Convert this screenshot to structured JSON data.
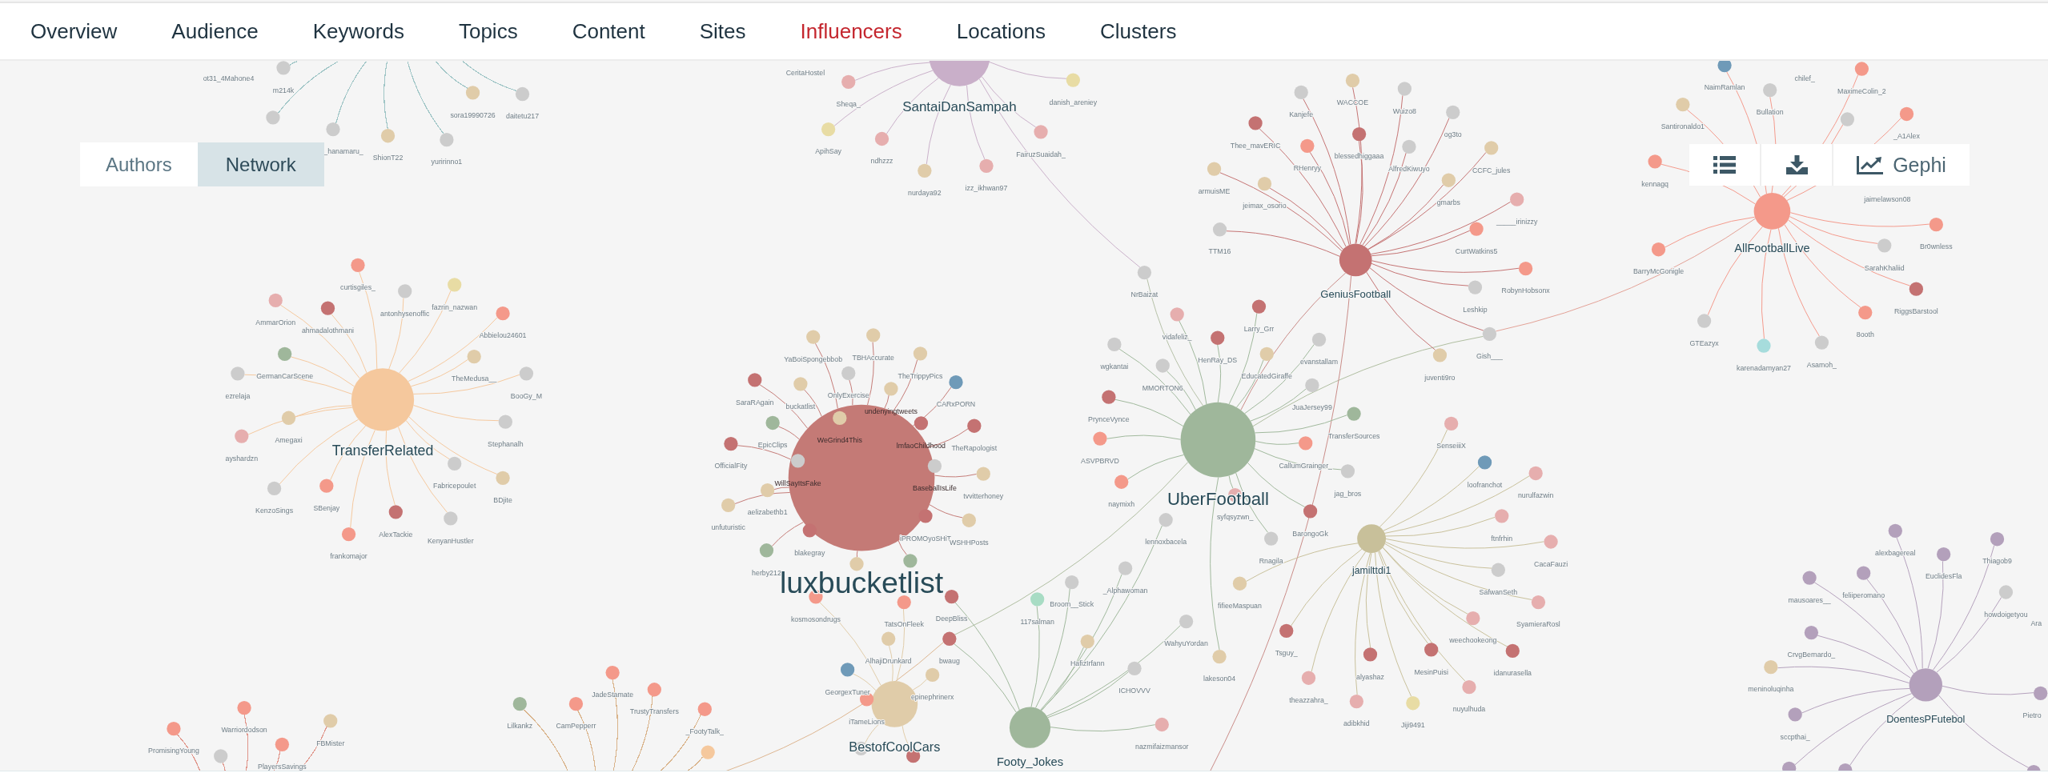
{
  "tabs": [
    {
      "label": "Overview",
      "selected": false
    },
    {
      "label": "Audience",
      "selected": false
    },
    {
      "label": "Keywords",
      "selected": false
    },
    {
      "label": "Topics",
      "selected": false
    },
    {
      "label": "Content",
      "selected": false
    },
    {
      "label": "Sites",
      "selected": false
    },
    {
      "label": "Influencers",
      "selected": true
    },
    {
      "label": "Locations",
      "selected": false
    },
    {
      "label": "Clusters",
      "selected": false
    }
  ],
  "view_toggle": [
    {
      "label": "Authors",
      "selected": false
    },
    {
      "label": "Network",
      "selected": true
    }
  ],
  "toolbar": [
    {
      "kind": "list"
    },
    {
      "kind": "download"
    },
    {
      "kind": "chart",
      "label": "Gephi"
    }
  ],
  "network": {
    "clusters": [
      {
        "color": "#9fc5c6",
        "leaves": [
          {
            "label": "ot31_4Mahone4"
          },
          {
            "label": "m214k",
            "color": "#cccccc"
          },
          {
            "label": "sora19990726",
            "color": "#e0cca9"
          },
          {
            "label": "daitetu217",
            "color": "#cccccc"
          },
          {
            "color": "#cccccc"
          },
          {
            "label": "_hanamaru_",
            "color": "#cccccc"
          },
          {
            "label": "ShionT22",
            "color": "#e0cca9"
          },
          {
            "label": "yuririnno1",
            "color": "#cccccc"
          }
        ]
      },
      {
        "color": "#c9afc9",
        "hub": {
          "label": "SantaiDanSampah"
        },
        "leaves": [
          {
            "label": "CeritaHostel"
          },
          {
            "label": "Sheqa_",
            "color": "#e6aeae"
          },
          {
            "label": "danish_areniey",
            "color": "#e8dca4"
          },
          {
            "label": "ApihSay",
            "color": "#e8dca4"
          },
          {
            "label": "ndhzzz",
            "color": "#e6aeae"
          },
          {
            "label": "FairuzSuaidah_",
            "color": "#e6aeae"
          },
          {
            "label": "nurdaya92",
            "color": "#e0cca9"
          },
          {
            "label": "izz_ikhwan97",
            "color": "#e6aeae"
          },
          {
            "label": "NrBaizat",
            "color": "#cccccc"
          }
        ]
      },
      {
        "color": "#c47272",
        "hub": {
          "label": "GeniusFootball"
        },
        "leaves": [
          {
            "label": "WACCOE",
            "color": "#e0cca9"
          },
          {
            "label": "Kanjefe",
            "color": "#cccccc"
          },
          {
            "label": "Wuizo8",
            "color": "#cccccc"
          },
          {
            "label": "og3to",
            "color": "#cccccc"
          },
          {
            "label": "Thee_mavERIC",
            "color": "#c47272"
          },
          {
            "label": "blessedhiggaaa",
            "color": "#c47272"
          },
          {
            "label": "RHenryy",
            "color": "#f4998a"
          },
          {
            "label": "AlfredKiwuyo",
            "color": "#cccccc"
          },
          {
            "label": "CCFC_jules",
            "color": "#e0cca9"
          },
          {
            "label": "armuisME",
            "color": "#e0cca9"
          },
          {
            "label": "jeimax_osorio",
            "color": "#e0cca9"
          },
          {
            "label": "gmarbs",
            "color": "#e0cca9"
          },
          {
            "label": "_____irinizzy",
            "color": "#e6aeae"
          },
          {
            "label": "TTM16",
            "color": "#cccccc"
          },
          {
            "label": "CurtWatkins5",
            "color": "#f4998a"
          },
          {
            "label": "RobynHobsonx",
            "color": "#f4998a"
          },
          {
            "label": "Leshkip",
            "color": "#cccccc"
          },
          {
            "label": "Gish___",
            "color": "#cccccc"
          },
          {
            "label": "juventi9ro",
            "color": "#e0cca9"
          }
        ]
      },
      {
        "color": "#f4998a",
        "hub": {
          "label": "AllFootballLive"
        },
        "leaves": [
          {
            "label": "chilef_"
          },
          {
            "label": "NaimRamlan",
            "color": "#6f9ab8"
          },
          {
            "label": "MaximeColin_2",
            "color": "#f4998a"
          },
          {
            "label": "Bullation",
            "color": "#cccccc"
          },
          {
            "label": "Santironaldo1",
            "color": "#e0cca9"
          },
          {
            "color": "#cccccc"
          },
          {
            "label": "_A1Alex",
            "color": "#f4998a"
          },
          {
            "label": "kennagq",
            "color": "#f4998a"
          },
          {
            "label": "jaimelawson08"
          },
          {
            "label": "Br0wnless",
            "color": "#f4998a"
          },
          {
            "label": "BarryMcGonigle",
            "color": "#f4998a"
          },
          {
            "label": "SarahKhaliid",
            "color": "#cccccc"
          },
          {
            "label": "RiggsBarstool",
            "color": "#c47272"
          },
          {
            "label": "8ooth",
            "color": "#f4998a"
          },
          {
            "label": "GTEazyx",
            "color": "#cccccc"
          },
          {
            "label": "karenadamyan27",
            "color": "#a6dcdc"
          },
          {
            "label": "Asamoh_",
            "color": "#cccccc"
          }
        ]
      },
      {
        "color": "#f5c89d",
        "hub": {
          "label": "TransferRelated"
        },
        "leaves": [
          {
            "label": "curtisgiles_",
            "color": "#f4998a"
          },
          {
            "label": "antonhysenoffic",
            "color": "#cccccc"
          },
          {
            "label": "fazrin_nazwan",
            "color": "#e8dca4"
          },
          {
            "label": "AmmarOrion",
            "color": "#e6aeae"
          },
          {
            "label": "ahmadalothmani",
            "color": "#c47272"
          },
          {
            "label": "Abbielou24601",
            "color": "#f4998a"
          },
          {
            "label": "GermanCarScene",
            "color": "#9fb79b"
          },
          {
            "label": "TheMedusa__",
            "color": "#e0cca9"
          },
          {
            "label": "ezrelaja",
            "color": "#cccccc"
          },
          {
            "label": "BooGy_M",
            "color": "#cccccc"
          },
          {
            "label": "Amegaxi",
            "color": "#e0cca9"
          },
          {
            "label": "Stephanalh",
            "color": "#cccccc"
          },
          {
            "label": "ayshardzn",
            "color": "#e6aeae"
          },
          {
            "label": "Fabricepoulet",
            "color": "#cccccc"
          },
          {
            "label": "KenzoSings",
            "color": "#cccccc"
          },
          {
            "label": "SBenjay",
            "color": "#f4998a"
          },
          {
            "label": "BDjite",
            "color": "#e0cca9"
          },
          {
            "label": "AlexTackie",
            "color": "#c47272"
          },
          {
            "label": "KenyanHustler",
            "color": "#cccccc"
          },
          {
            "label": "frankomajor",
            "color": "#f4998a"
          }
        ]
      },
      {
        "color": "#c47a76",
        "hub": {
          "label": "luxbucketlist"
        },
        "leaves": [
          {
            "label": "YaBoiSpongebbob",
            "color": "#e0cca9"
          },
          {
            "label": "TBHAccurate",
            "color": "#e0cca9"
          },
          {
            "label": "TheTrippyPics",
            "color": "#e0cca9"
          },
          {
            "label": "SaraRAgain",
            "color": "#c47272"
          },
          {
            "label": "buckatlist",
            "color": "#e0cca9"
          },
          {
            "label": "OnlyExercise",
            "color": "#cccccc"
          },
          {
            "label": "undenyingtweets",
            "color": "#e0cca9"
          },
          {
            "label": "CARxPORN",
            "color": "#6f9ab8"
          },
          {
            "label": "EpicClips",
            "color": "#9fb79b"
          },
          {
            "label": "WeGrind4This",
            "color": "#e0cca9"
          },
          {
            "label": "lmfaoChildhood",
            "color": "#c47272"
          },
          {
            "label": "TheRapologist",
            "color": "#c47272"
          },
          {
            "label": "OfficialFity",
            "color": "#c47272"
          },
          {
            "label": "WillSayItsFake",
            "color": "#cccccc"
          },
          {
            "label": "BaseballIsLife",
            "color": "#cccccc"
          },
          {
            "label": "tvvitterhoney",
            "color": "#e0cca9"
          },
          {
            "label": "aelizabethb1",
            "color": "#e0cca9"
          },
          {
            "label": "unfuturistic",
            "color": "#e0cca9"
          },
          {
            "label": "iPROMOyoSHiT",
            "color": "#c47272"
          },
          {
            "label": "WSHHPosts",
            "color": "#e0cca9"
          },
          {
            "label": "blakegray",
            "color": "#c47272"
          },
          {
            "label": "herby212",
            "color": "#9fb79b"
          },
          {
            "color": "#e0cca9"
          },
          {
            "color": "#9fb79b"
          }
        ]
      },
      {
        "color": "#e0cca9",
        "hub": {
          "label": "BestofCoolCars"
        },
        "leaves": [
          {
            "label": "kosmosondrugs",
            "color": "#f4998a"
          },
          {
            "label": "TatsOnFleek",
            "color": "#f4998a"
          },
          {
            "label": "AlhajiDrunkard",
            "color": "#e0cca9"
          },
          {
            "label": "GeorgexTuner",
            "color": "#6f9ab8"
          },
          {
            "label": "epinephrinerx",
            "color": "#e0cca9"
          },
          {
            "label": "iTameLions",
            "color": "#f4998a"
          },
          {
            "color": "#cccccc"
          },
          {
            "color": "#c47272"
          }
        ]
      },
      {
        "color": "#9fb79b",
        "hub": {
          "label": "Footy_Jokes"
        },
        "leaves": [
          {
            "label": "lennoxbacela",
            "color": "#cccccc"
          },
          {
            "label": "_Alphawoman",
            "color": "#cccccc"
          },
          {
            "label": "Broom__Stick",
            "color": "#cccccc"
          },
          {
            "label": "DeepBliss",
            "color": "#c47272"
          },
          {
            "label": "117salman",
            "color": "#a8dcc4"
          },
          {
            "label": "WahyuYordan",
            "color": "#cccccc"
          },
          {
            "label": "bwaug",
            "color": "#c47272"
          },
          {
            "label": "HafizIrfann",
            "color": "#e0cca9"
          },
          {
            "label": "ICHOVVV",
            "color": "#cccccc"
          },
          {
            "label": "nazmifaizmansor",
            "color": "#e6aeae"
          }
        ]
      },
      {
        "color": "#9fb79b",
        "hub": {
          "label": "UberFootball"
        },
        "leaves": [
          {
            "label": "vidafeliz_",
            "color": "#e6aeae"
          },
          {
            "label": "Larry_Grr",
            "color": "#c47272"
          },
          {
            "label": "wgkantai",
            "color": "#cccccc"
          },
          {
            "label": "HenRay_DS",
            "color": "#c47272"
          },
          {
            "label": "evanstallam",
            "color": "#cccccc"
          },
          {
            "label": "EducatedGiraffe",
            "color": "#e0cca9"
          },
          {
            "label": "MMORTON6",
            "color": "#cccccc"
          },
          {
            "label": "JuaJersey99",
            "color": "#cccccc"
          },
          {
            "label": "PrynceVynce",
            "color": "#c47272"
          },
          {
            "label": "TransferSources",
            "color": "#9fb79b"
          },
          {
            "label": "ASVPBRVD",
            "color": "#f4998a"
          },
          {
            "label": "CallumGrainger_",
            "color": "#f4998a"
          },
          {
            "label": "jag_bros",
            "color": "#cccccc"
          },
          {
            "label": "naymixh",
            "color": "#f4998a"
          },
          {
            "label": "syfqsyzwn_",
            "color": "#e6aeae"
          },
          {
            "label": "BarongoGk",
            "color": "#c47272"
          },
          {
            "label": "Rnagila",
            "color": "#cccccc"
          },
          {
            "label": "lakeson04",
            "color": "#e0cca9"
          }
        ]
      },
      {
        "color": "#c8c09a",
        "hub": {
          "label": "jamilttdi1"
        },
        "leaves": [
          {
            "label": "SenseiiiX",
            "color": "#e6aeae"
          },
          {
            "label": "loofranchot",
            "color": "#6f9ab8"
          },
          {
            "label": "nurulfazwin",
            "color": "#e6aeae"
          },
          {
            "label": "ftnfrhin",
            "color": "#e6aeae"
          },
          {
            "label": "CacaFauzi",
            "color": "#e6aeae"
          },
          {
            "label": "SafwanSeth",
            "color": "#cccccc"
          },
          {
            "label": "fifieeMaspuan",
            "color": "#e0cca9"
          },
          {
            "label": "SyamieraRosl",
            "color": "#e6aeae"
          },
          {
            "label": "weechookeong",
            "color": "#e6aeae"
          },
          {
            "label": "Tsguy_",
            "color": "#c47272"
          },
          {
            "label": "alyashaz",
            "color": "#c47272"
          },
          {
            "label": "MesinPuisi",
            "color": "#c47272"
          },
          {
            "label": "idanurasella",
            "color": "#c47272"
          },
          {
            "label": "theazzahra_",
            "color": "#e6aeae"
          },
          {
            "label": "nuyulhuda",
            "color": "#e6aeae"
          },
          {
            "label": "adibkhid",
            "color": "#e6aeae"
          },
          {
            "label": "Jiji9491",
            "color": "#e8dca4"
          }
        ]
      },
      {
        "color": "#b3a0bb",
        "hub": {
          "label": "DoentesPFutebol"
        },
        "leaves": [
          {
            "label": "alexbagereal",
            "color": "#b3a0bb"
          },
          {
            "label": "Thiagob9",
            "color": "#b3a0bb"
          },
          {
            "label": "EuclidesFla",
            "color": "#b3a0bb"
          },
          {
            "label": "mausoares__",
            "color": "#b3a0bb"
          },
          {
            "label": "feliiperomano",
            "color": "#b3a0bb"
          },
          {
            "label": "howdoigetyou",
            "color": "#cccccc"
          },
          {
            "label": "Ara"
          },
          {
            "label": "CrvgBernardo_",
            "color": "#b3a0bb"
          },
          {
            "label": "meninoluqinha",
            "color": "#e0cca9"
          },
          {
            "label": "Pietro",
            "color": "#b3a0bb"
          },
          {
            "label": "sccpthai_",
            "color": "#b3a0bb"
          },
          {
            "color": "#b3a0bb"
          },
          {
            "color": "#b3a0bb"
          },
          {
            "color": "#b3a0bb"
          }
        ]
      },
      {
        "color": "#e0958a",
        "leaves": [
          {
            "label": "Warriordodson",
            "color": "#f4998a"
          },
          {
            "label": "PromisingYoung",
            "color": "#f4998a"
          },
          {
            "label": "FBMister",
            "color": "#e0cca9"
          },
          {
            "label": "PlayersSavings",
            "color": "#f4998a"
          },
          {
            "color": "#cccccc"
          }
        ]
      },
      {
        "color": "#d9b38a",
        "leaves": [
          {
            "label": "JadeStamate",
            "color": "#f4998a"
          },
          {
            "label": "TrustyTransfers",
            "color": "#f4998a"
          },
          {
            "label": "Lilkankz",
            "color": "#9fb79b"
          },
          {
            "label": "CamPepperr",
            "color": "#f4998a"
          },
          {
            "label": "_FootyTalk_",
            "color": "#f4998a"
          },
          {
            "color": "#f5c89d"
          }
        ]
      }
    ]
  }
}
